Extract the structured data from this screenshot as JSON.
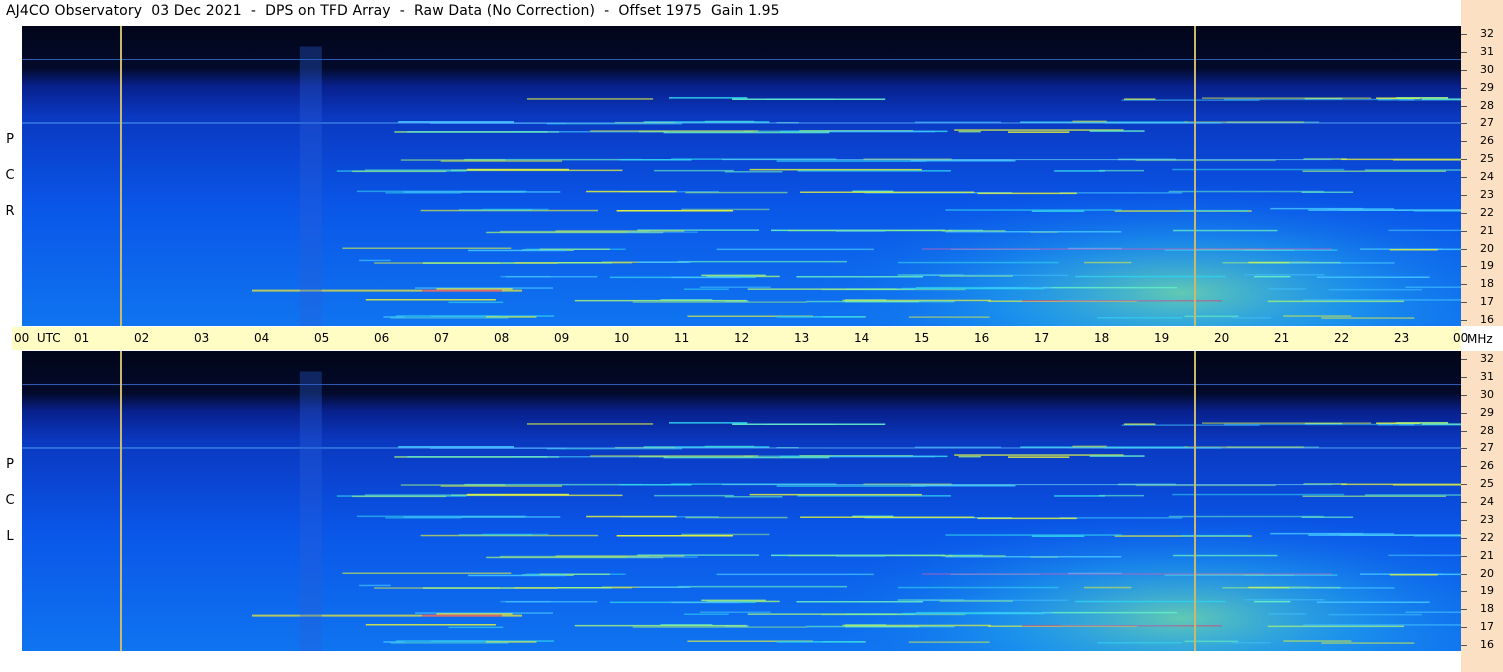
{
  "title": "AJ4CO Observatory  03 Dec 2021  -  DPS on TFD Array  -  Raw Data (No Correction)  -  Offset 1975  Gain 1.95",
  "panels": [
    {
      "label": [
        "P",
        "C",
        "R"
      ]
    },
    {
      "label": [
        "P",
        "C",
        "L"
      ]
    }
  ],
  "freq_ticks": [
    "32",
    "31",
    "30",
    "29",
    "28",
    "27",
    "26",
    "25",
    "24",
    "23",
    "22",
    "21",
    "20",
    "19",
    "18",
    "17",
    "16"
  ],
  "time_ticks": [
    "00  UTC",
    "01",
    "02",
    "03",
    "04",
    "05",
    "06",
    "07",
    "08",
    "09",
    "10",
    "11",
    "12",
    "13",
    "14",
    "15",
    "16",
    "17",
    "18",
    "19",
    "20",
    "21",
    "22",
    "23",
    "00"
  ],
  "mhz_label": "MHz",
  "colors": {
    "cursor": "#c8b870",
    "freq_axis_bg": "#fbe0c4",
    "time_axis_bg": "#fffcc4"
  },
  "chart_data": [
    {
      "type": "heatmap",
      "x": "UTC hour",
      "xlim": [
        0,
        24
      ],
      "y": "MHz",
      "ylim": [
        16,
        32
      ],
      "grid": false,
      "markers_utc": [
        1.65,
        19.55
      ]
    },
    {
      "type": "heatmap",
      "x": "UTC hour",
      "xlim": [
        0,
        24
      ],
      "y": "MHz",
      "ylim": [
        16,
        32
      ],
      "grid": false,
      "markers_utc": [
        1.65,
        19.55
      ]
    }
  ]
}
